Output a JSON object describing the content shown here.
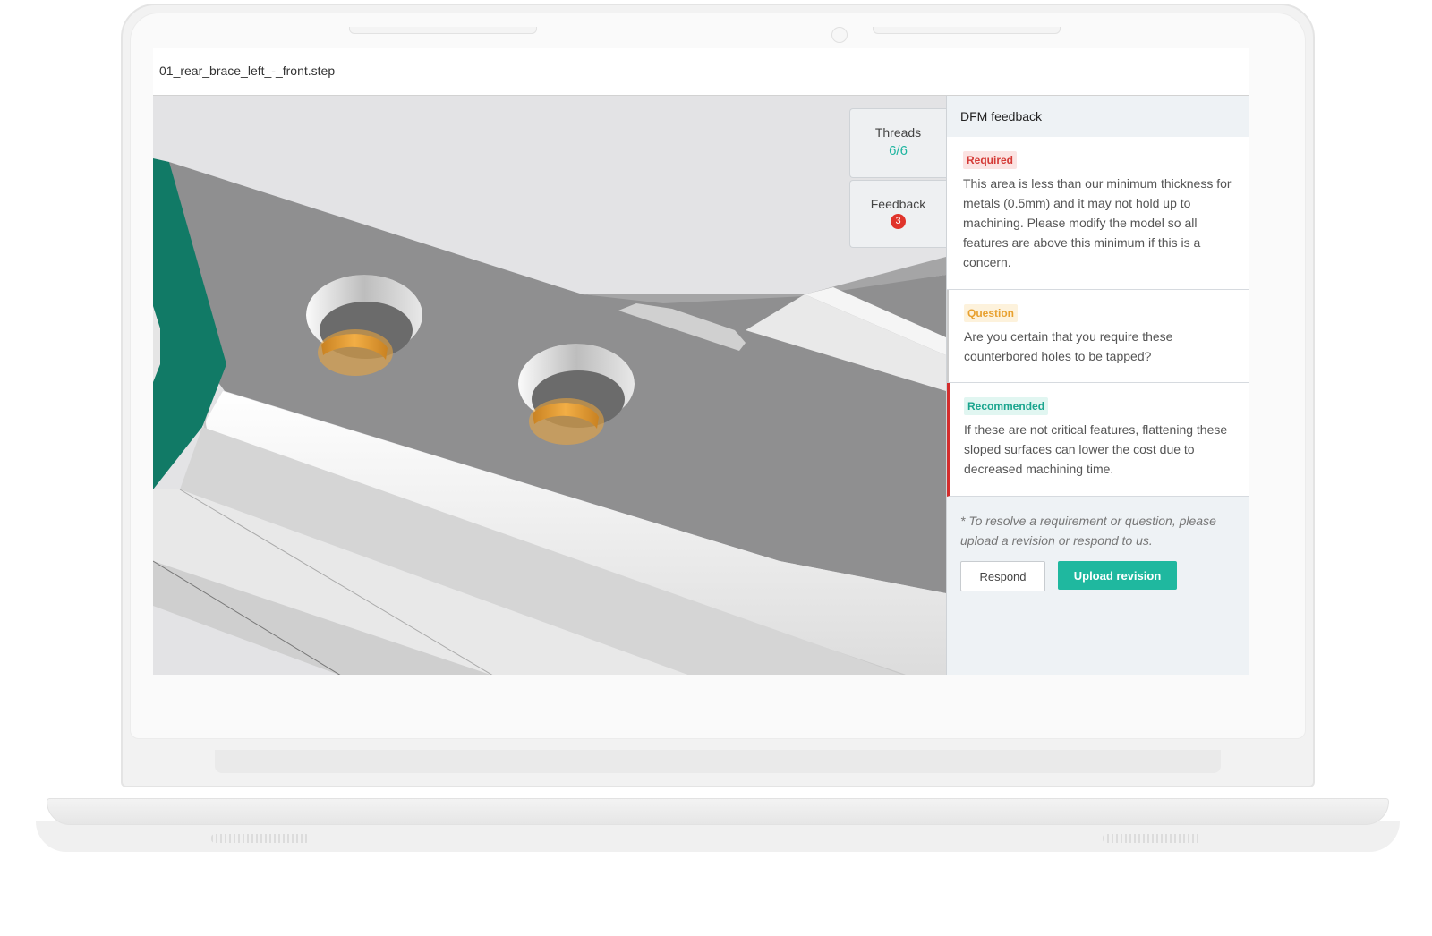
{
  "window": {
    "file_title": "01_rear_brace_left_-_front.step"
  },
  "viewport": {
    "tabs": [
      {
        "label": "Threads",
        "count": "6/6"
      },
      {
        "label": "Feedback",
        "count": "3"
      }
    ],
    "colors": {
      "accent_face": "#117a66",
      "thread_highlight": "#f0a83a",
      "part_grey": "#8e8e8e"
    }
  },
  "panel": {
    "title": "DFM feedback",
    "items": [
      {
        "tag": "Required",
        "text": "This area is less than our minimum thickness for metals (0.5mm) and it may not hold up to machining. Please modify the model so all features are above this minimum if this is a concern."
      },
      {
        "tag": "Question",
        "text": "Are you certain that you require these counterbored holes to be tapped?"
      },
      {
        "tag": "Recommended",
        "text": "If these are not critical features, flattening these sloped surfaces can lower the cost due to decreased machining time."
      }
    ],
    "note": "* To resolve a requirement or question, please upload a revision or respond to us.",
    "respond_label": "Respond",
    "upload_label": "Upload revision"
  },
  "colors": {
    "primary": "#1fb89f",
    "required": "#d43a36",
    "question": "#e8a130",
    "recommended": "#1aa58e"
  }
}
